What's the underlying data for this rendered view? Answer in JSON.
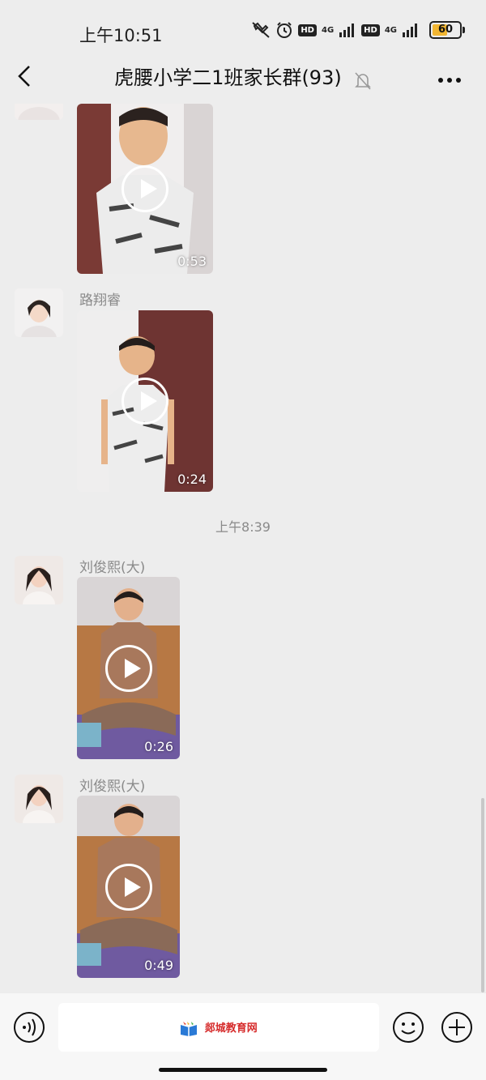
{
  "status_bar": {
    "time": "上午10:51",
    "hd_label": "HD",
    "network_label": "4G",
    "battery_level": "60",
    "battery_fraction": 0.6
  },
  "nav": {
    "title": "虎腰小学二1班家长群(93)",
    "back_icon": "chevron-left-icon",
    "mute_icon": "bell-off-icon",
    "more_icon": "more-horizontal-icon"
  },
  "messages": [
    {
      "sender": "",
      "duration": "0:53"
    },
    {
      "sender": "路翔睿",
      "duration": "0:24"
    },
    {
      "sender": "刘俊熙(大)",
      "duration": "0:26"
    },
    {
      "sender": "刘俊熙(大)",
      "duration": "0:49"
    }
  ],
  "timestamp": "上午8:39",
  "input": {
    "watermark": "郯城教育网",
    "voice_icon": "voice-icon",
    "emoji_icon": "smiley-icon",
    "plus_icon": "plus-circle-icon"
  },
  "colors": {
    "background": "#ededed",
    "battery": "#f2b632",
    "watermark": "#d62b2b"
  }
}
